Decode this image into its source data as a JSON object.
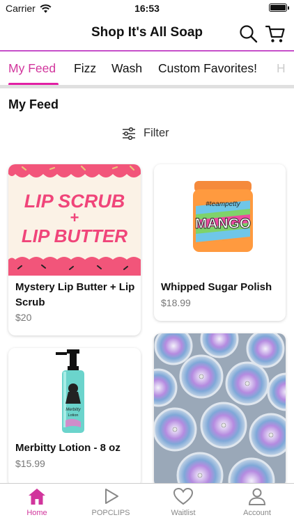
{
  "status_bar": {
    "carrier": "Carrier",
    "time": "16:53"
  },
  "header": {
    "title": "Shop It's All Soap",
    "icons": [
      "search-icon",
      "cart-icon"
    ]
  },
  "tabs": [
    {
      "label": "My Feed",
      "active": true
    },
    {
      "label": "Fizz",
      "active": false
    },
    {
      "label": "Wash",
      "active": false
    },
    {
      "label": "Custom Favorites!",
      "active": false
    },
    {
      "label": "H",
      "active": false
    }
  ],
  "section_title": "My Feed",
  "filter_label": "Filter",
  "products": [
    {
      "title": "Mystery Lip Butter + Lip Scrub",
      "price": "$20",
      "banner_text": [
        "LIP SCRUB",
        "+",
        "LIP BUTTER"
      ]
    },
    {
      "title": "Whipped Sugar Polish",
      "price": "$18.99",
      "jar_brand": "#teampetty",
      "jar_label": "MANGO"
    },
    {
      "title": "Merbitty Lotion - 8 oz",
      "price": "$15.99",
      "bottle_label": [
        "Merbitty",
        "Lotion"
      ]
    },
    {
      "title": "",
      "price": ""
    }
  ],
  "bottom_nav": [
    {
      "label": "Home",
      "icon": "home-icon",
      "active": true
    },
    {
      "label": "POPCLIPS",
      "icon": "play-icon",
      "active": false
    },
    {
      "label": "Waitlist",
      "icon": "heart-icon",
      "active": false
    },
    {
      "label": "Account",
      "icon": "person-icon",
      "active": false
    }
  ],
  "colors": {
    "accent": "#d1359c",
    "divider": "#c64fc9",
    "banner_pink": "#f2557a",
    "banner_cream": "#fbf2e6"
  }
}
